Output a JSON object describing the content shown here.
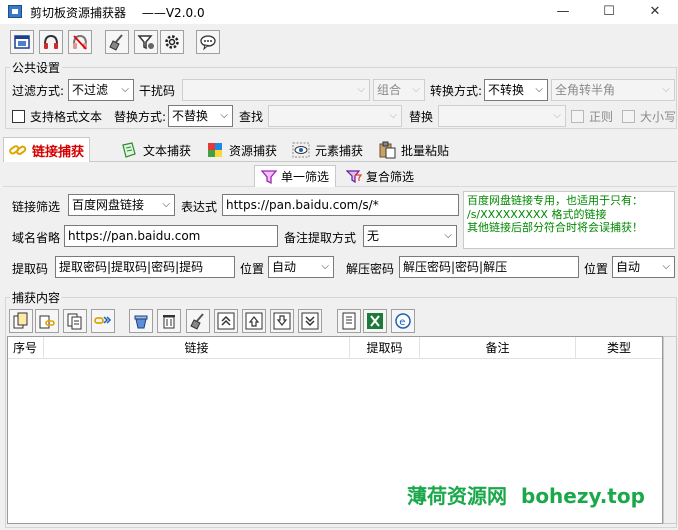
{
  "window": {
    "title": "剪切板资源捕获器",
    "version": "——V2.0.0",
    "controls": [
      "—",
      "☐",
      "✕"
    ]
  },
  "toolbar": {
    "icons": [
      "app-window-icon",
      "headset-icon",
      "no-headset-icon",
      "broom-icon",
      "filter-settings-icon",
      "gear-icon",
      "chat-bubble-icon"
    ]
  },
  "public_settings": {
    "title": "公共设置",
    "filter_mode_label": "过滤方式:",
    "filter_mode_value": "不过滤",
    "noise_label": "干扰码",
    "noise_value": "",
    "combine_value": "组合",
    "convert_label": "转换方式:",
    "convert_value": "不转换",
    "width_convert_value": "全角转半角",
    "format_text_label": "支持格式文本",
    "replace_label": "替换方式:",
    "replace_value": "不替换",
    "find_label": "查找",
    "find_value": "",
    "replace_with_label": "替换",
    "replace_with_value": "",
    "regex_label": "正则",
    "case_label": "大小写"
  },
  "tabs": [
    {
      "label": "链接捕获",
      "icon": "chain-link-icon"
    },
    {
      "label": "文本捕获",
      "icon": "text-doc-icon"
    },
    {
      "label": "资源捕获",
      "icon": "resource-cube-icon"
    },
    {
      "label": "元素捕获",
      "icon": "eye-scan-icon"
    },
    {
      "label": "批量粘贴",
      "icon": "clipboard-paste-icon"
    }
  ],
  "subtabs": [
    {
      "label": "单一筛选",
      "icon": "funnel-icon"
    },
    {
      "label": "复合筛选",
      "icon": "funnel-multi-icon"
    }
  ],
  "link_filter": {
    "filter_label": "链接筛选",
    "filter_value": "百度网盘链接",
    "expression_label": "表达式",
    "expression_value": "https://pan.baidu.com/s/*",
    "domain_label": "域名省略",
    "domain_value": "https://pan.baidu.com",
    "note_label": "备注提取方式",
    "note_value": "无",
    "code_label": "提取码",
    "code_value": "提取密码|提取码|密码|提码",
    "code_pos_label": "位置",
    "code_pos_value": "自动",
    "unzip_label": "解压密码",
    "unzip_value": "解压密码|密码|解压",
    "unzip_pos_label": "位置",
    "unzip_pos_value": "自动",
    "hint_lines": [
      "百度网盘链接专用，也适用于只有：",
      "/s/XXXXXXXXX 格式的链接",
      "其他链接后部分符合时将会误捕获！"
    ]
  },
  "capture": {
    "title": "捕获内容",
    "toolbar_icons": [
      "copy-doc-icon",
      "copy-link-icon",
      "copy-all-icon",
      "copy-chain-icon",
      "clear-icon",
      "trash-icon",
      "broom-icon",
      "move-top-icon",
      "move-up-icon",
      "move-down-icon",
      "move-bottom-icon",
      "export-txt-icon",
      "export-excel-icon",
      "open-browser-icon"
    ],
    "columns": [
      "序号",
      "链接",
      "提取码",
      "备注",
      "类型"
    ],
    "rows": []
  },
  "watermark": {
    "text_cn": "薄荷资源网",
    "text_en": "bohezy.top"
  },
  "colors": {
    "active_tab_text": "#d60000",
    "hint_text": "#008800",
    "watermark": "#1aa84a"
  }
}
